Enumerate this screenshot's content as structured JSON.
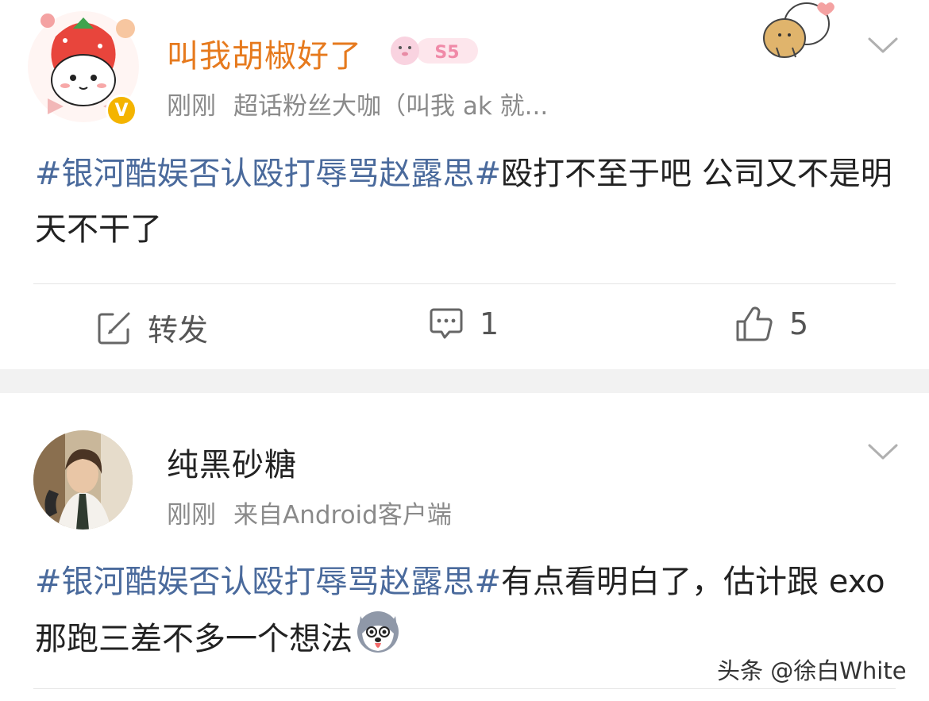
{
  "posts": [
    {
      "author": "叫我胡椒好了",
      "author_color": "#e67a1e",
      "level_badge": "S5",
      "verified_mark": "V",
      "time": "刚刚",
      "source": "超话粉丝大咖（叫我 ak 就...",
      "hashtag": "#银河酷娱否认殴打辱骂赵露思#",
      "text": "殴打不至于吧 公司又不是明天不干了",
      "actions": {
        "repost_label": "转发",
        "comment_count": "1",
        "like_count": "5"
      }
    },
    {
      "author": "纯黑砂糖",
      "author_color": "#222222",
      "time": "刚刚",
      "source": "来自Android客户端",
      "hashtag": "#银河酷娱否认殴打辱骂赵露思#",
      "text": "有点看明白了，估计跟 exo 那跑三差不多一个想法"
    }
  ],
  "watermark": "头条 @徐白White",
  "icons": [
    "repost-icon",
    "comment-icon",
    "like-icon",
    "chevron-down-icon",
    "husky-emoji-icon"
  ],
  "colors": {
    "hashtag": "#4a6a9c",
    "meta": "#8a8a8a",
    "separator": "#f2f2f2"
  }
}
